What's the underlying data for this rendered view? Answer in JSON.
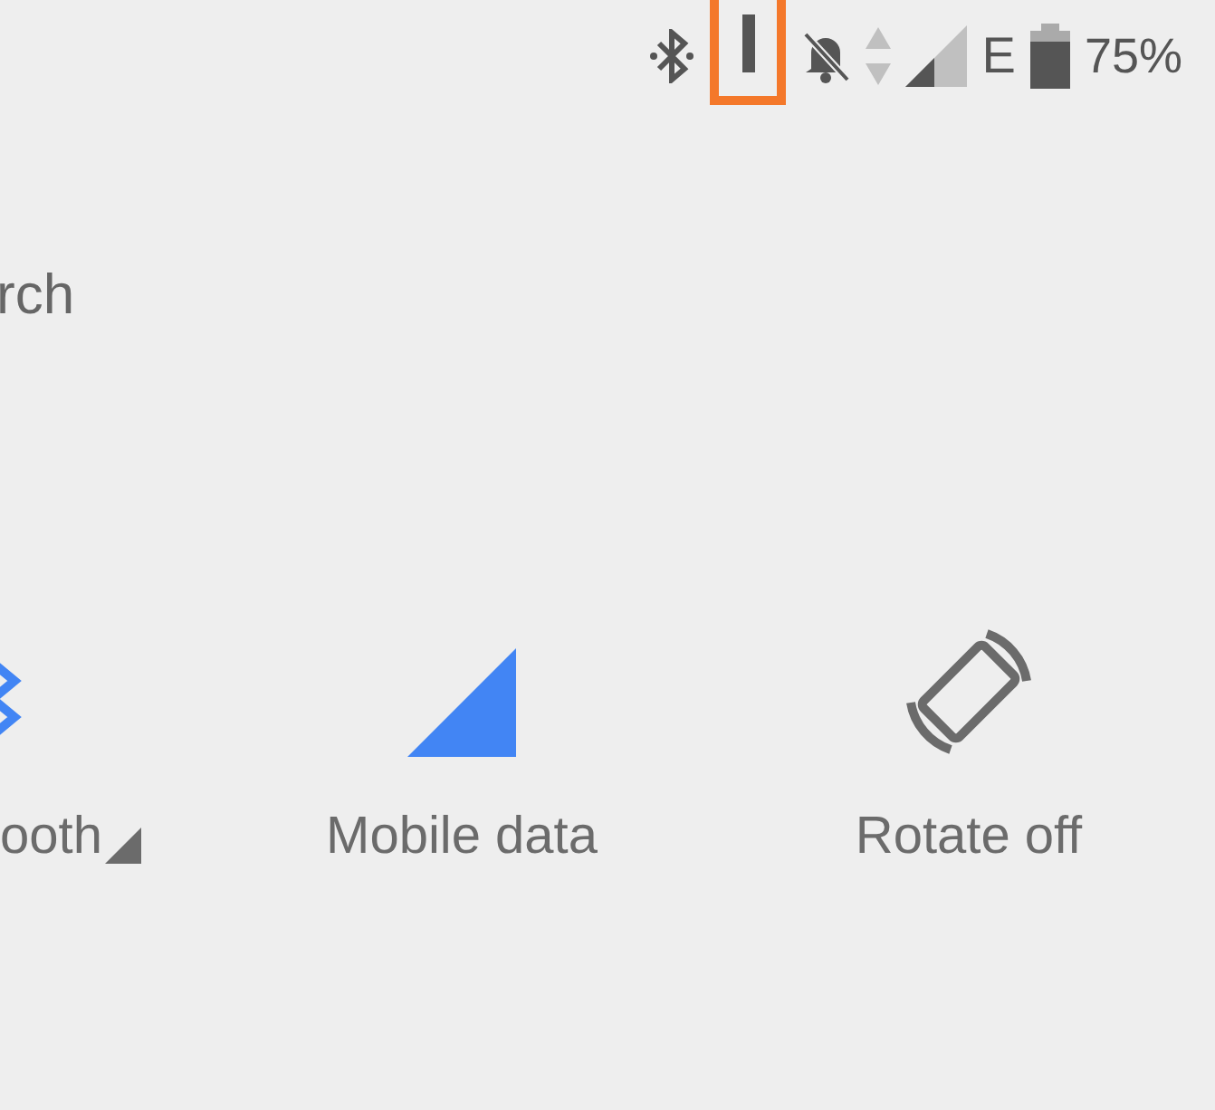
{
  "status_bar": {
    "network_type": "E",
    "battery": "75%",
    "highlighted_icon": true
  },
  "search": {
    "label": "rch"
  },
  "tiles": [
    {
      "kind": "bluetooth",
      "label": "ooth",
      "on": true,
      "has_menu": true
    },
    {
      "kind": "mobile_data",
      "label": "Mobile data",
      "on": true,
      "has_menu": false
    },
    {
      "kind": "rotate",
      "label": "Rotate off",
      "on": false,
      "has_menu": false
    }
  ]
}
